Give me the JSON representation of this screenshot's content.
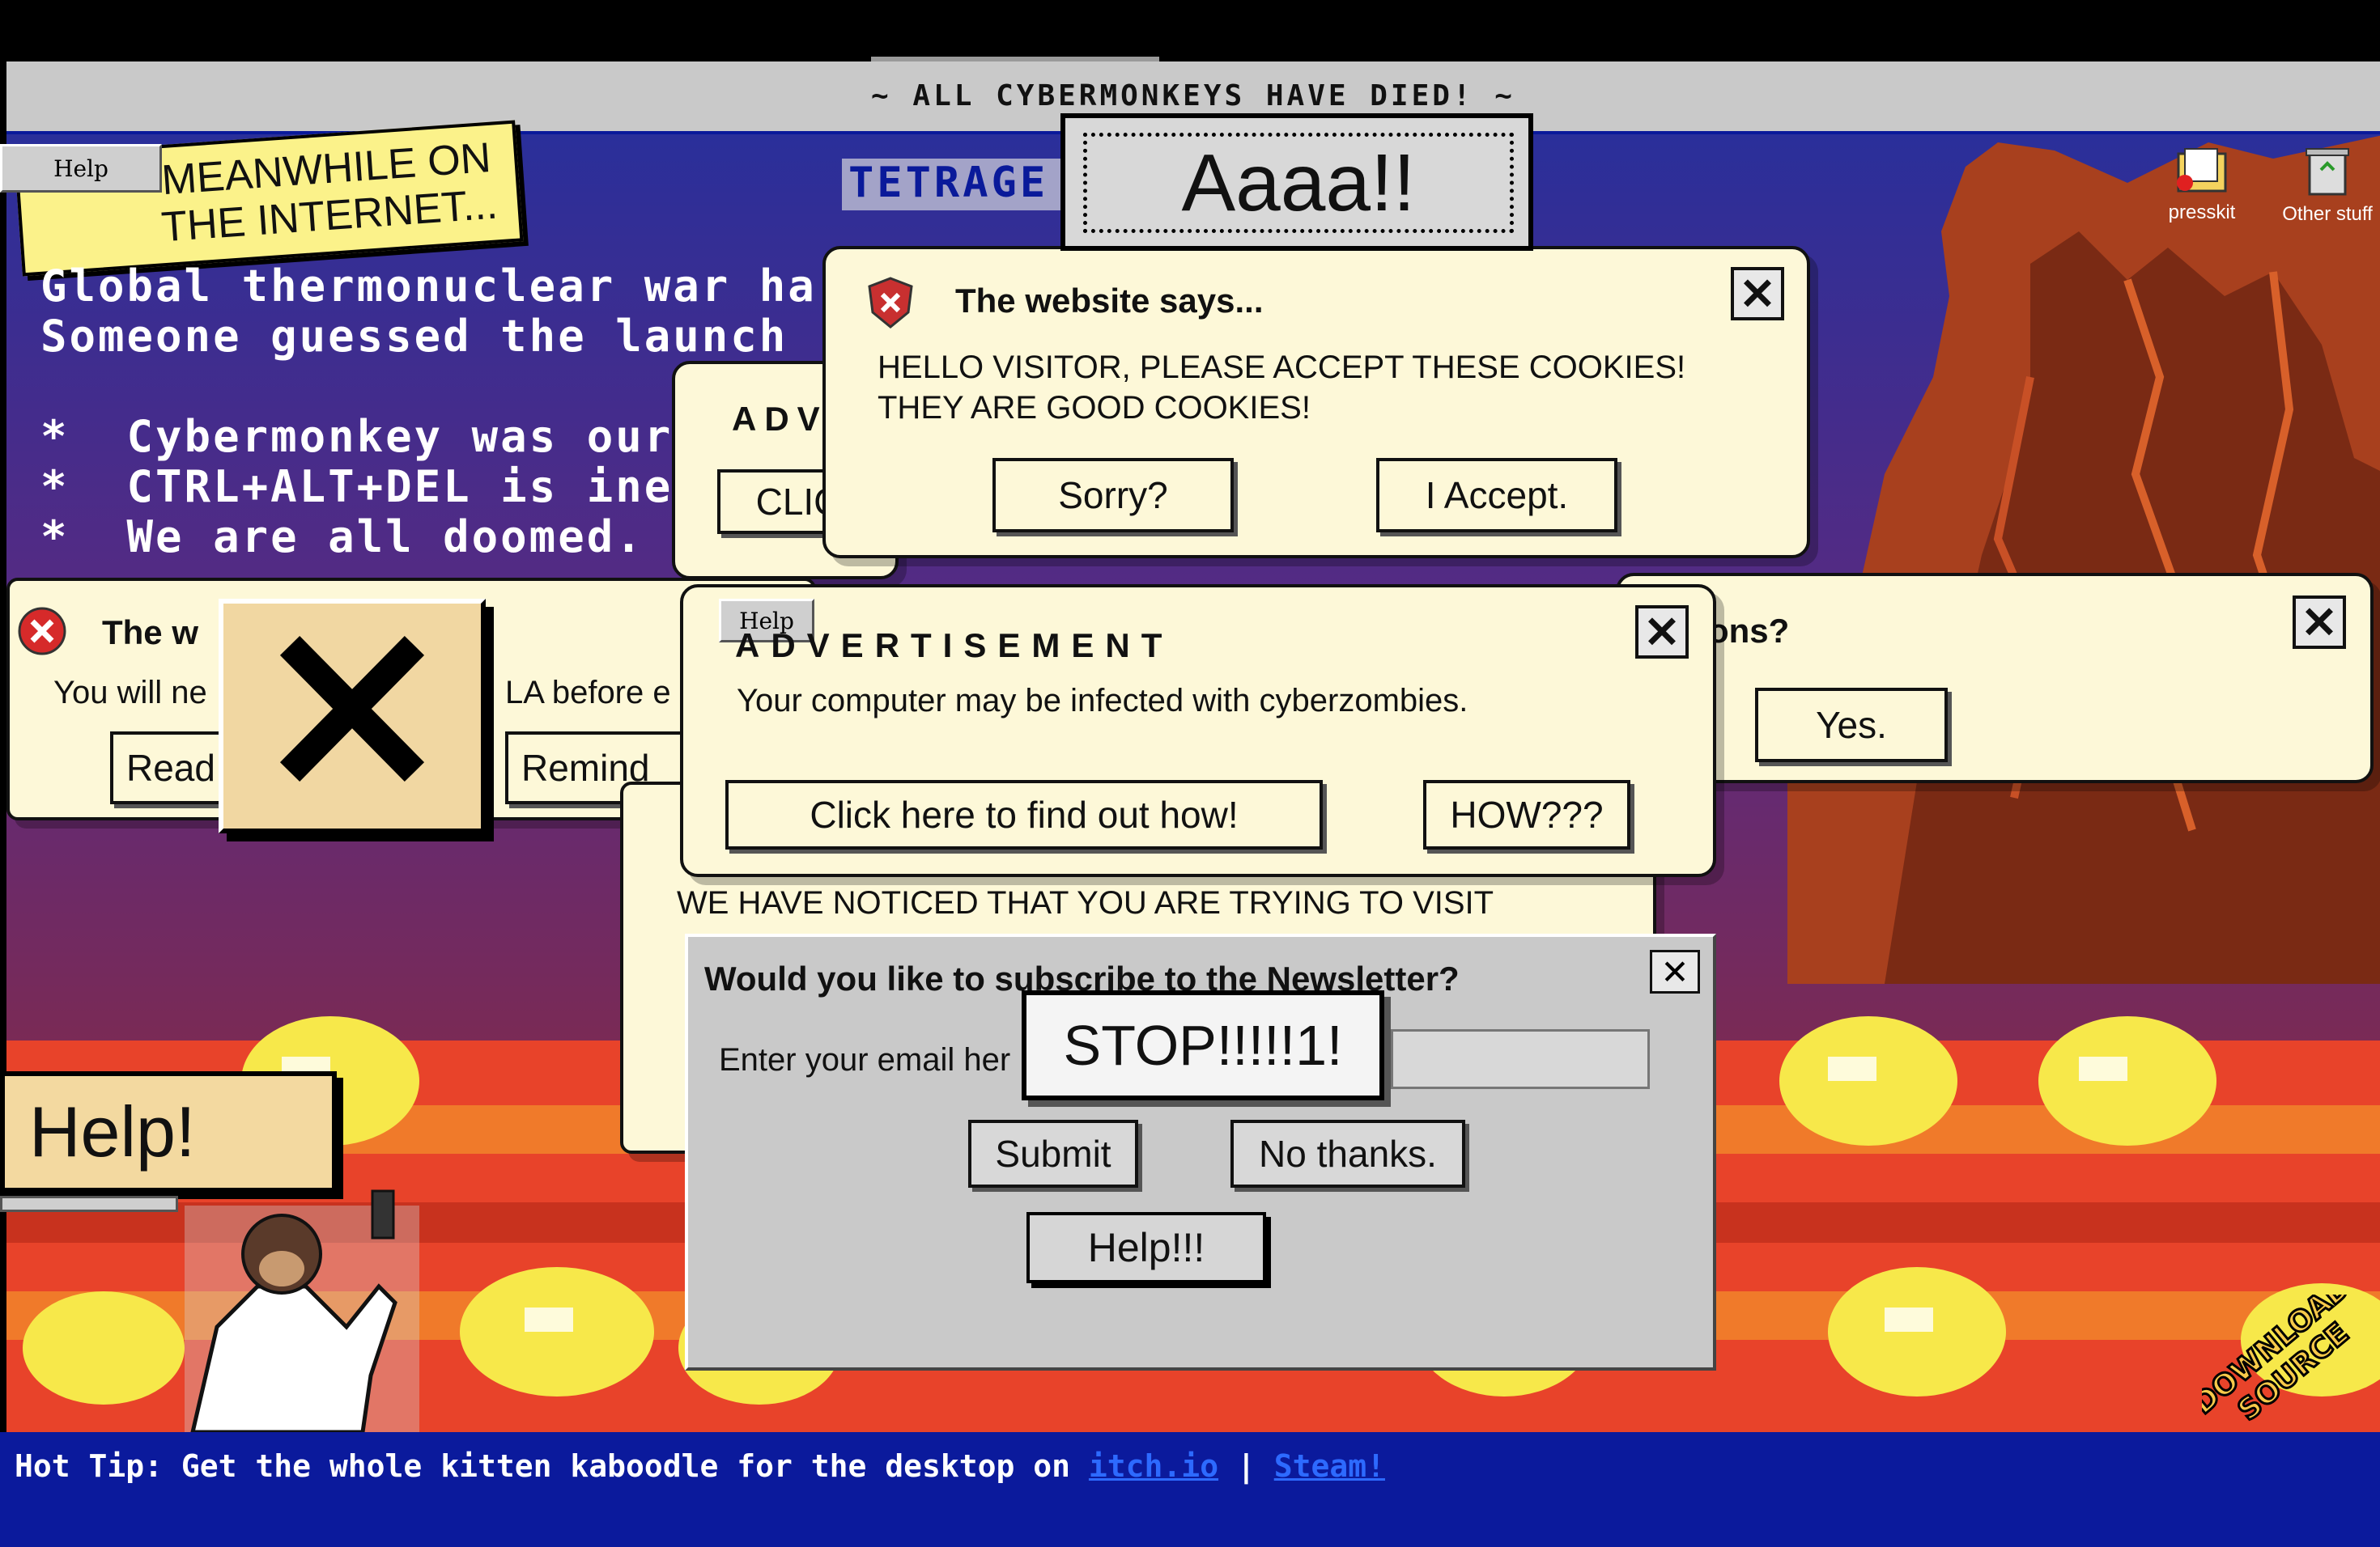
{
  "title": "~ ALL CYBERMONKEYS HAVE DIED! ~",
  "caption": {
    "text": "MEANWHILE ON THE INTERNET..."
  },
  "tetrage_label": "TETRAGE",
  "terminal": {
    "line1": "Global thermonuclear war ha",
    "line2": "Someone guessed the launch",
    "bullets": [
      "*  Cybermonkey was our",
      "*  CTRL+ALT+DEL is ine",
      "*  We are all doomed."
    ]
  },
  "help_small_label": "Help",
  "aaaa_label": "Aaaa!!",
  "desktop_icons": [
    {
      "label": "presskit",
      "icon": "folder-alert-icon"
    },
    {
      "label": "Other stuff",
      "icon": "recycle-bin-icon"
    }
  ],
  "cookie_popup": {
    "title": "The website says...",
    "line1": "HELLO VISITOR, PLEASE ACCEPT THESE COOKIES!",
    "line2": "THEY ARE GOOD COOKIES!",
    "btn_sorry": "Sorry?",
    "btn_accept": "I Accept."
  },
  "ad_back": {
    "title": "ADV",
    "btn": "CLIC"
  },
  "left_popup": {
    "title": "The w",
    "text": "You will ne",
    "text2": "LA before e",
    "btn_read": "Read",
    "btn_remind": "Remind"
  },
  "right_popup": {
    "title": "ons?",
    "btn_yes": "Yes."
  },
  "ad_popup": {
    "help": "Help",
    "title": "ADVERTISEMENT",
    "text": "Your computer may be infected with cyberzombies.",
    "btn_find": "Click here to find out how!",
    "btn_how": "HOW???"
  },
  "notice_popup": {
    "line1": "WE HAVE NOTICED THAT YOU ARE TRYING TO VISIT"
  },
  "newsletter": {
    "title": "Would you like to subscribe to the Newsletter?",
    "label": "Enter your email her",
    "btn_submit": "Submit",
    "btn_no": "No thanks."
  },
  "stop_label": "STOP!!!!!1!",
  "help3_label": "Help!!!",
  "help_big_label": "Help!",
  "hot_tip": {
    "text": "Hot Tip: Get the whole kitten kaboodle for the desktop on ",
    "link1": "itch.io",
    "sep": " | ",
    "link2": "Steam!"
  },
  "download_source": {
    "line1": "DOWNLOAD",
    "line2": "SOURCE"
  },
  "colors": {
    "bg_blue": "#0b1a9c",
    "popup_cream": "#fdf8d8",
    "lava_red": "#e8432a",
    "lava_yellow": "#f7e84a"
  }
}
